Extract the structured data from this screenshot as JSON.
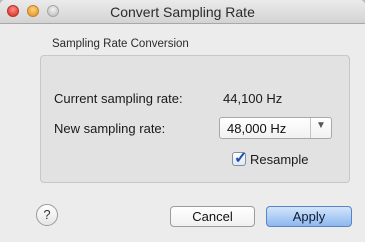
{
  "window": {
    "title": "Convert Sampling Rate"
  },
  "group": {
    "label": "Sampling Rate Conversion",
    "current_rate_label": "Current sampling rate:",
    "current_rate_value": "44,100 Hz",
    "new_rate_label": "New sampling rate:",
    "new_rate_value": "48,000 Hz",
    "resample_label": "Resample",
    "resample_checked": true
  },
  "footer": {
    "help_glyph": "?",
    "cancel_label": "Cancel",
    "apply_label": "Apply"
  },
  "icons": {
    "close": "close-icon",
    "minimize": "minimize-icon",
    "zoom": "zoom-icon",
    "dropdown": "chevron-down-icon",
    "help": "help-icon"
  },
  "colors": {
    "window_bg": "#ececec",
    "default_button": "#8db8ef",
    "close": "#e0443a",
    "minimize": "#e9a23b"
  }
}
